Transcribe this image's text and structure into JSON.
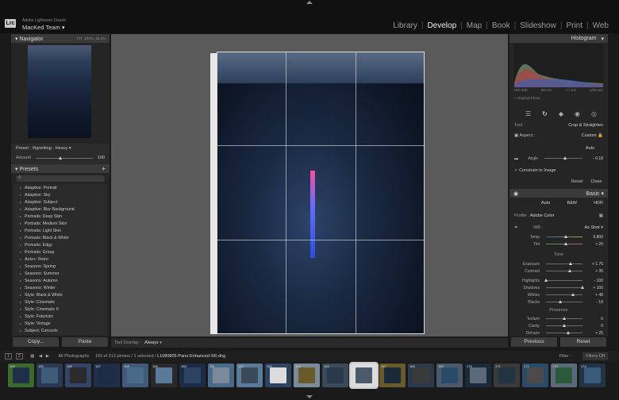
{
  "app": {
    "name": "Adobe Lightroom Classic",
    "identity": "MacKed Team",
    "logo": "Lrc"
  },
  "modules": [
    "Library",
    "Develop",
    "Map",
    "Book",
    "Slideshow",
    "Print",
    "Web"
  ],
  "active_module": "Develop",
  "navigator": {
    "title": "Navigator",
    "zoom_fit": "FIT",
    "zoom_100": "100%",
    "zoom_other": "33.3%"
  },
  "preset_row": {
    "preset_label": "Preset :",
    "preset_value": "Vignetting - Heavy",
    "amount_label": "Amount",
    "amount_value": "100"
  },
  "presets": {
    "title": "Presets",
    "search_placeholder": "",
    "items": [
      "Adaptive: Portrait",
      "Adaptive: Sky",
      "Adaptive: Subject",
      "Adaptive: Blur Background",
      "Portraits: Deep Skin",
      "Portraits: Medium Skin",
      "Portraits: Light Skin",
      "Portraits: Black & White",
      "Portraits: Edgy",
      "Portraits: Group",
      "Auto+: Retro",
      "Seasons: Spring",
      "Seasons: Summer",
      "Seasons: Autumn",
      "Seasons: Winter",
      "Style: Black & White",
      "Style: Cinematic",
      "Style: Cinematic II",
      "Style: Futuristic",
      "Style: Vintage",
      "Subject: Concerts"
    ]
  },
  "left_buttons": {
    "copy": "Copy...",
    "paste": "Paste"
  },
  "toolbar": {
    "overlay_label": "Tool Overlay :",
    "overlay_value": "Always"
  },
  "histogram": {
    "title": "Histogram",
    "iso": "ISO 400",
    "focal": "90 mm",
    "aperture": "ƒ / 4.0",
    "shutter": "1/25 sec",
    "original_photo": "Original Photo"
  },
  "crop": {
    "tool_label": "Tool :",
    "tool_value": "Crop & Straighten",
    "aspect_label": "Aspect :",
    "aspect_value": "Custom",
    "auto": "Auto",
    "angle_label": "Angle",
    "angle_value": "- 0.18",
    "constrain": "Constrain to Image",
    "reset": "Reset",
    "close": "Close"
  },
  "basic": {
    "title": "Basic",
    "treatments": [
      "Auto",
      "B&W",
      "HDR"
    ],
    "profile_label": "Profile :",
    "profile_value": "Adobe Color",
    "wb_label": "WB :",
    "wb_value": "As Shot",
    "temp_label": "Temp",
    "temp_value": "5,800",
    "temp_frac": 0.55,
    "tint_label": "Tint",
    "tint_value": "+ 20",
    "tint_frac": 0.56,
    "tone_title": "Tone",
    "exposure_label": "Exposure",
    "exposure_value": "+ 1.76",
    "exposure_frac": 0.68,
    "contrast_label": "Contrast",
    "contrast_value": "+ 35",
    "contrast_frac": 0.67,
    "highlights_label": "Highlights",
    "highlights_value": "- 100",
    "highlights_frac": 0.0,
    "shadows_label": "Shadows",
    "shadows_value": "+ 100",
    "shadows_frac": 1.0,
    "whites_label": "Whites",
    "whites_value": "+ 48",
    "whites_frac": 0.74,
    "blacks_label": "Blacks",
    "blacks_value": "- 19",
    "blacks_frac": 0.41,
    "presence_title": "Presence",
    "texture_label": "Texture",
    "texture_value": "0",
    "texture_frac": 0.5,
    "clarity_label": "Clarity",
    "clarity_value": "0",
    "clarity_frac": 0.5,
    "dehaze_label": "Dehaze",
    "dehaze_value": "+ 25",
    "dehaze_frac": 0.62
  },
  "right_buttons": {
    "previous": "Previous",
    "reset": "Reset"
  },
  "filmbar": {
    "page1": "1",
    "page2": "2",
    "source": "All Photographs",
    "count": "156 of 313 photos / 1 selected /",
    "filename": "L1080805-Pano-Enhanced-SR.dng",
    "filter_label": "Filter :",
    "filter_value": "Filters Off"
  },
  "filmstrip": {
    "numbers": [
      "154",
      "155",
      "156",
      "157",
      "158",
      "159",
      "160",
      "161",
      "162",
      "163",
      "164",
      "165",
      "166",
      "167",
      "168",
      "169",
      "170",
      "171",
      "172",
      "173",
      "174",
      "175",
      "176",
      "177",
      "178",
      "179",
      "180"
    ],
    "colors": [
      "#3b6b2a",
      "#2a3a55",
      "#334466",
      "#1f2f4a",
      "#405a7a",
      "#2a2a2a",
      "#1c2c46",
      "#4a6a8a",
      "#5a7a9a",
      "#2c4462",
      "#7a8a9a",
      "#3a4a5a",
      "#dcdcdc",
      "#6a5a2a",
      "#2a3a4a",
      "#4a5a6a",
      "#1a2a3a",
      "#3a3a3a",
      "#2a4a6a",
      "#5a6a7a",
      "#223344",
      "#4b4b4b",
      "#2a5a3a",
      "#3a5a7a",
      "#556677",
      "#2b2b2b",
      "#666677"
    ]
  }
}
